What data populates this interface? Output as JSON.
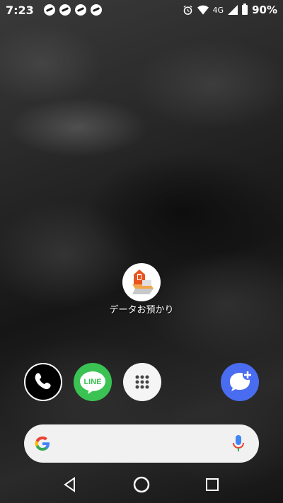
{
  "status_bar": {
    "time": "7:23",
    "notification_icons": [
      "app-notification-icon",
      "app-notification-icon",
      "app-notification-icon",
      "app-notification-icon"
    ],
    "network": "4G",
    "battery": "90%",
    "icons": [
      "alarm-icon",
      "wifi-icon",
      "signal-icon",
      "battery-icon"
    ]
  },
  "home_app": {
    "label": "データお預かり",
    "icon": "data-backup-icon",
    "accent": "#e8531f"
  },
  "dock": [
    {
      "name": "phone",
      "icon": "phone-icon",
      "color": "#000000"
    },
    {
      "name": "line",
      "icon": "line-icon",
      "label": "LINE",
      "color": "#3ac253"
    },
    {
      "name": "app-drawer",
      "icon": "apps-grid-icon",
      "color": "#f5f5f5"
    },
    {
      "name": "messages",
      "icon": "message-plus-icon",
      "color": "#4a6cf0"
    }
  ],
  "search_bar": {
    "logo": "google-logo",
    "mic": "mic-icon"
  },
  "navigation": [
    "back-icon",
    "home-icon",
    "recents-icon"
  ]
}
